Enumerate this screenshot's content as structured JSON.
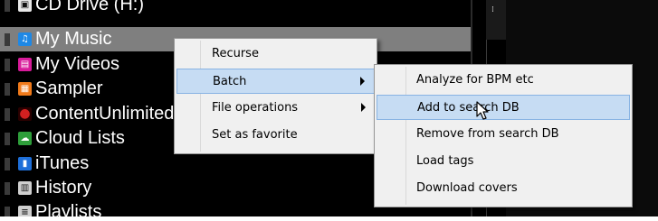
{
  "tree_items": [
    {
      "label": "CD Drive (H:)",
      "icon": "cd-drive-icon",
      "color": "#e8e8e8",
      "glyph": "▣"
    },
    {
      "label": "My Music",
      "icon": "music-icon",
      "color": "#1e88e5",
      "glyph": "♫",
      "selected": true
    },
    {
      "label": "My Videos",
      "icon": "video-icon",
      "color": "#d81b9a",
      "glyph": "▤"
    },
    {
      "label": "Sampler",
      "icon": "sampler-icon",
      "color": "#f07a1a",
      "glyph": "▦"
    },
    {
      "label": "ContentUnlimited",
      "icon": "content-unlimited-icon",
      "color": "#d32020",
      "glyph": "●"
    },
    {
      "label": "Cloud Lists",
      "icon": "cloud-icon",
      "color": "#2e9e3a",
      "glyph": "☁"
    },
    {
      "label": "iTunes",
      "icon": "itunes-icon",
      "color": "#1e6fd9",
      "glyph": "▮"
    },
    {
      "label": "History",
      "icon": "history-icon",
      "color": "#cfcfcf",
      "glyph": "▥"
    },
    {
      "label": "Playlists",
      "icon": "playlists-icon",
      "color": "#cfcfcf",
      "glyph": "≡"
    }
  ],
  "context_menu": {
    "items": [
      {
        "label": "Recurse",
        "submenu": false
      },
      {
        "label": "Batch",
        "submenu": true,
        "highlighted": true
      },
      {
        "label": "File operations",
        "submenu": true
      },
      {
        "label": "Set as favorite",
        "submenu": false
      }
    ]
  },
  "batch_submenu": {
    "items": [
      {
        "label": "Analyze for BPM etc"
      },
      {
        "label": "Add to search DB",
        "highlighted": true
      },
      {
        "label": "Remove from search DB"
      },
      {
        "label": "Load tags"
      },
      {
        "label": "Download covers"
      }
    ]
  },
  "colors": {
    "highlight": "#c6dcf3",
    "selected_row": "#7f7f7f",
    "background": "#000000"
  }
}
